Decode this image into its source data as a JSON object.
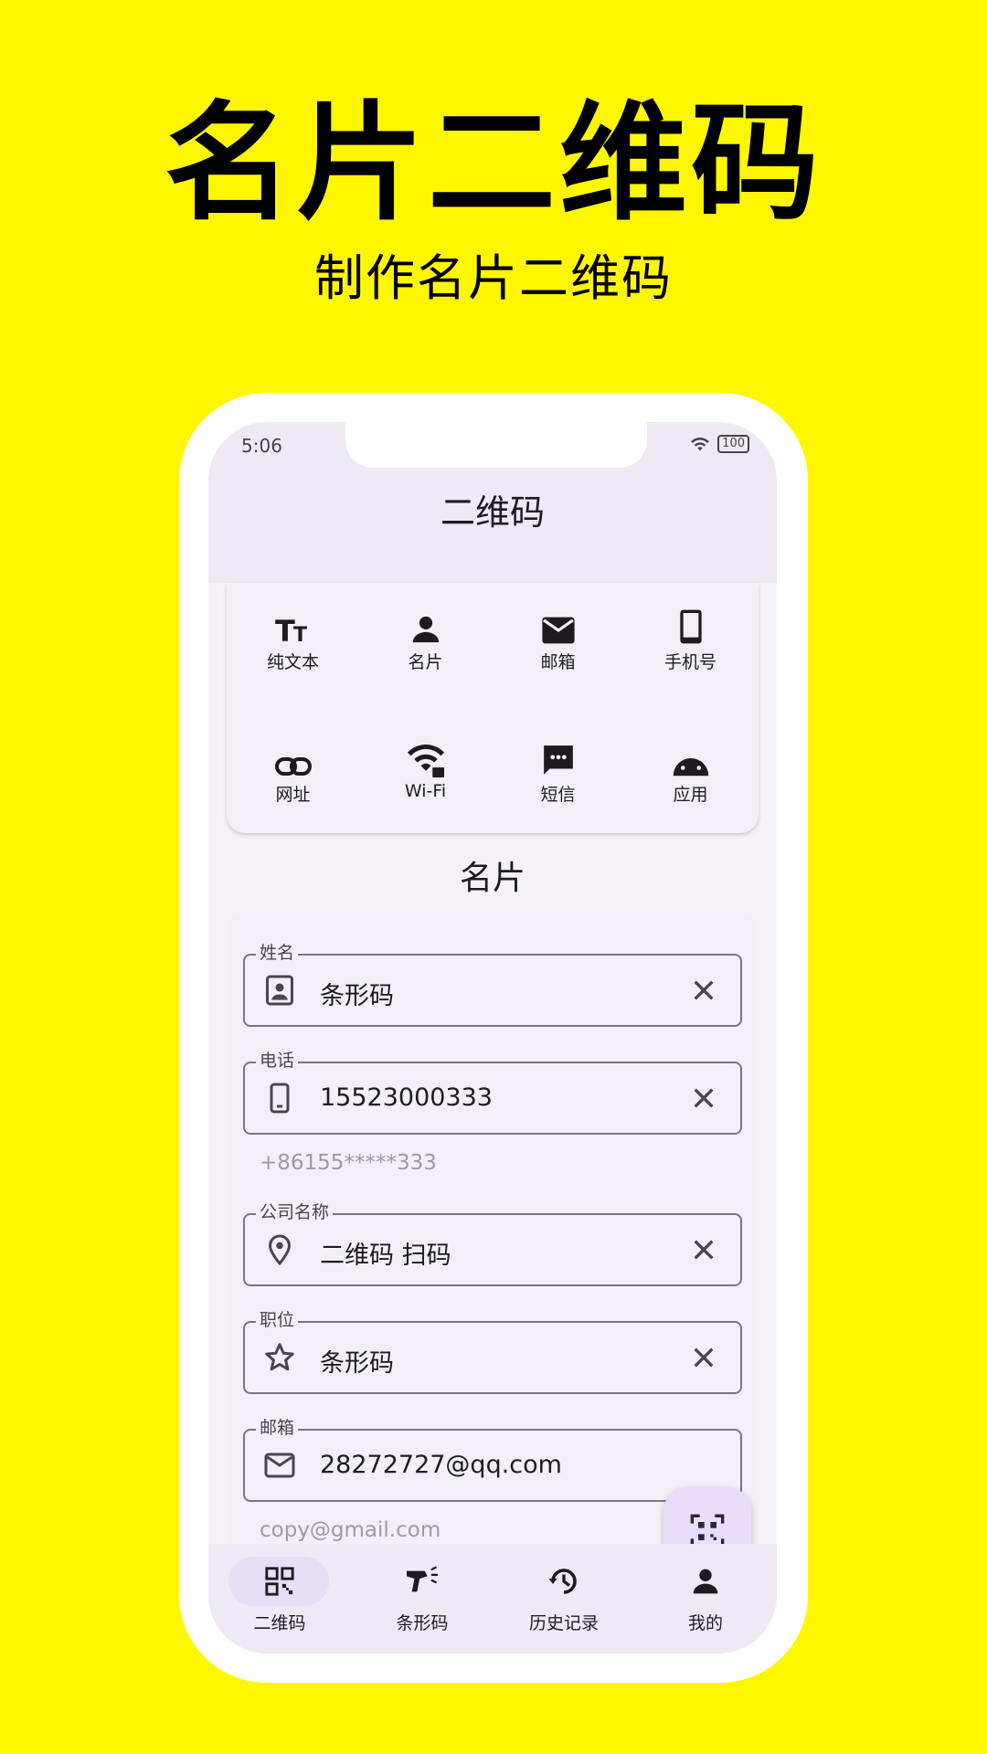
{
  "promo": {
    "title": "名片二维码",
    "subtitle": "制作名片二维码"
  },
  "status": {
    "time": "5:06",
    "battery": "100"
  },
  "appbar": {
    "title": "二维码"
  },
  "types": [
    {
      "label": "纯文本",
      "icon": "text-icon"
    },
    {
      "label": "名片",
      "icon": "person-icon"
    },
    {
      "label": "邮箱",
      "icon": "mail-icon"
    },
    {
      "label": "手机号",
      "icon": "phone-icon"
    },
    {
      "label": "网址",
      "icon": "link-icon"
    },
    {
      "label": "Wi-Fi",
      "icon": "wifi-icon"
    },
    {
      "label": "短信",
      "icon": "sms-icon"
    },
    {
      "label": "应用",
      "icon": "android-icon"
    }
  ],
  "section": {
    "title": "名片"
  },
  "form": {
    "name": {
      "label": "姓名",
      "value": "条形码"
    },
    "phone": {
      "label": "电话",
      "value": "15523000333",
      "helper": "+86155*****333"
    },
    "company": {
      "label": "公司名称",
      "value": "二维码 扫码"
    },
    "position": {
      "label": "职位",
      "value": "条形码"
    },
    "email": {
      "label": "邮箱",
      "value": "28272727@qq.com",
      "helper": "copy@gmail.com"
    }
  },
  "nav": [
    {
      "label": "二维码",
      "icon": "qr-grid-icon",
      "active": true
    },
    {
      "label": "条形码",
      "icon": "scanner-icon",
      "active": false
    },
    {
      "label": "历史记录",
      "icon": "history-icon",
      "active": false
    },
    {
      "label": "我的",
      "icon": "person-icon",
      "active": false
    }
  ],
  "colors": {
    "background": "#FFF700",
    "accent": "#e8ddfa",
    "surface": "#f4eff7"
  }
}
